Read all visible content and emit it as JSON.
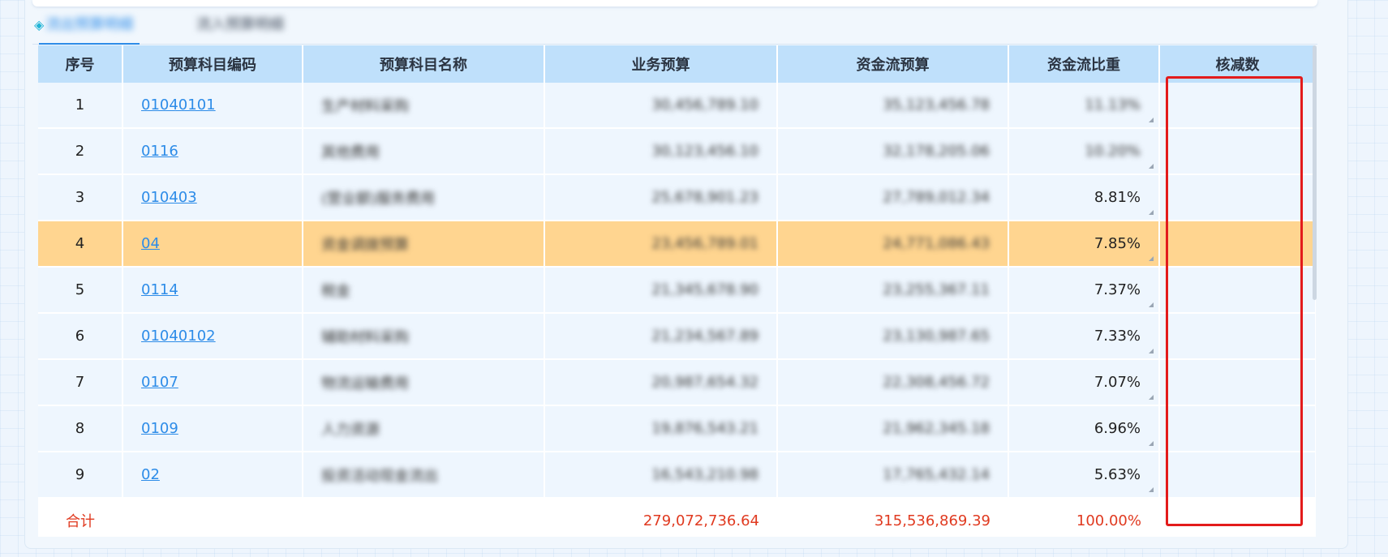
{
  "tabs": [
    {
      "label": "流出预算明细",
      "active": true
    },
    {
      "label": "流入预算明细",
      "active": false
    }
  ],
  "table": {
    "headers": [
      "序号",
      "预算科目编码",
      "预算科目名称",
      "业务预算",
      "资金流预算",
      "资金流比重",
      "核减数"
    ],
    "rows": [
      {
        "idx": "1",
        "code": "01040101",
        "name": "生产材料采购",
        "biz": "30,456,789.10",
        "flow": "35,123,456.78",
        "pct": "11.13%",
        "cut": ""
      },
      {
        "idx": "2",
        "code": "0116",
        "name": "其他费用",
        "biz": "30,123,456.10",
        "flow": "32,178,205.06",
        "pct": "10.20%",
        "cut": ""
      },
      {
        "idx": "3",
        "code": "010403",
        "name": "(营业额)服务费用",
        "biz": "25,678,901.23",
        "flow": "27,789,012.34",
        "pct": "8.81%",
        "cut": ""
      },
      {
        "idx": "4",
        "code": "04",
        "name": "资金调拨预算",
        "biz": "23,456,789.01",
        "flow": "24,771,086.43",
        "pct": "7.85%",
        "cut": "",
        "highlight": true
      },
      {
        "idx": "5",
        "code": "0114",
        "name": "税金",
        "biz": "21,345,678.90",
        "flow": "23,255,367.11",
        "pct": "7.37%",
        "cut": ""
      },
      {
        "idx": "6",
        "code": "01040102",
        "name": "辅助材料采购",
        "biz": "21,234,567.89",
        "flow": "23,130,987.65",
        "pct": "7.33%",
        "cut": ""
      },
      {
        "idx": "7",
        "code": "0107",
        "name": "物流运输费用",
        "biz": "20,987,654.32",
        "flow": "22,308,456.72",
        "pct": "7.07%",
        "cut": ""
      },
      {
        "idx": "8",
        "code": "0109",
        "name": "人力资源",
        "biz": "19,876,543.21",
        "flow": "21,962,345.18",
        "pct": "6.96%",
        "cut": ""
      },
      {
        "idx": "9",
        "code": "02",
        "name": "投资活动现金流出",
        "biz": "16,543,210.98",
        "flow": "17,765,432.14",
        "pct": "5.63%",
        "cut": ""
      }
    ],
    "footer": {
      "label": "合计",
      "biz": "279,072,736.64",
      "flow": "315,536,869.39",
      "pct": "100.00%",
      "cut": ""
    }
  },
  "colors": {
    "header_bg": "#bfe0fb",
    "row_bg": "#eef6fe",
    "highlight_bg": "#ffd590",
    "link": "#2d8ce8",
    "total_text": "#e03a20",
    "annotation_box": "#e31b1b"
  }
}
